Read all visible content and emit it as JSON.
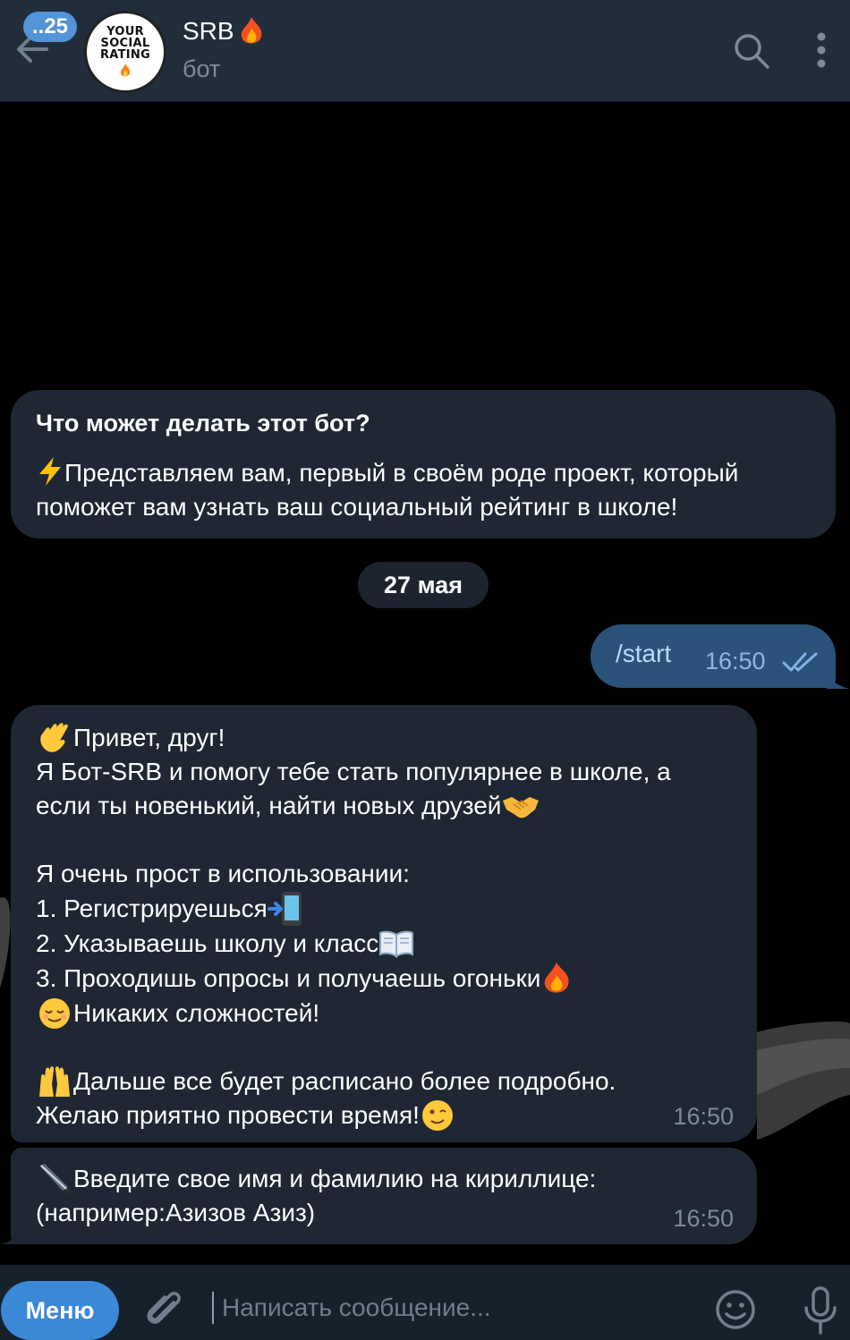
{
  "header": {
    "unread_count": "..25",
    "avatar_text": "YOUR\nSOCIAL\nRATING",
    "title": "SRB",
    "subtitle": "бот"
  },
  "info_card": {
    "title": "Что может делать этот бот?",
    "body": "Представляем вам, первый в своём роде проект, который\nпоможет вам узнать ваш социальный рейтинг в школе!"
  },
  "date_separator": "27 мая",
  "messages": [
    {
      "direction": "out",
      "text": "/start",
      "time": "16:50",
      "status": "read"
    },
    {
      "direction": "in",
      "lines": [
        "Привет, друг!",
        "Я Бот-SRB и помогу тебе стать популярнее в школе, а",
        "если ты новенький, найти новых друзей",
        "",
        "Я очень прост в использовании:",
        "1. Регистрируешься",
        "2. Указываешь школу и класс",
        "3. Проходишь опросы и получаешь огоньки",
        "Никаких сложностей!",
        "",
        "Дальше все будет расписано более подробно.",
        "Желаю приятно провести время!"
      ],
      "time": "16:50"
    },
    {
      "direction": "in",
      "lines": [
        "Введите свое имя и фамилию на кириллице:",
        "(например:Азизов Азиз)"
      ],
      "time": "16:50"
    }
  ],
  "input_bar": {
    "menu_label": "Меню",
    "placeholder": "Написать сообщение..."
  },
  "icons": [
    "back-arrow-icon",
    "search-icon",
    "more-vertical-icon",
    "attach-icon",
    "emoji-icon",
    "microphone-icon",
    "fire-icon",
    "lightning-icon",
    "wave-icon",
    "handshake-icon",
    "phone-icon",
    "book-icon",
    "relieved-face-icon",
    "raised-hands-icon",
    "wink-face-icon",
    "pen-icon"
  ],
  "colors": {
    "header_bg": "#212d3b",
    "bubble_in": "#1e2733",
    "bubble_out": "#2b5278",
    "accent": "#3a88d6",
    "badge": "#5294d6"
  }
}
